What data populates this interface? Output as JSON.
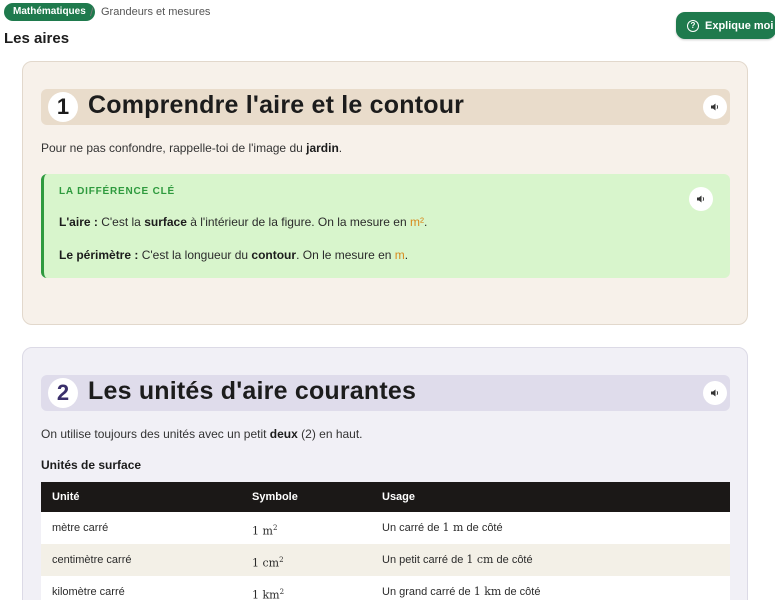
{
  "header": {
    "subject": "Mathématiques",
    "separator": "/",
    "topic": "Grandeurs et mesures",
    "title": "Les aires",
    "explain_button": "Explique moi",
    "explain_icon": "help-circle-icon"
  },
  "section1": {
    "number": "1",
    "title": "Comprendre l'aire et le contour",
    "intro_before": "Pour ne pas confondre, rappelle-toi de l'image du ",
    "intro_bold": "jardin",
    "intro_after": ".",
    "callout": {
      "title": "LA DIFFÉRENCE CLÉ",
      "area": {
        "label": "L'aire :",
        "text1": " C'est la ",
        "bold": "surface",
        "text2": " à l'intérieur de la figure. On la mesure en ",
        "unit": "m²",
        "end": "."
      },
      "perimeter": {
        "label": "Le périmètre :",
        "text1": " C'est la longueur du ",
        "bold": "contour",
        "text2": ". On le mesure en ",
        "unit": "m",
        "end": "."
      }
    }
  },
  "section2": {
    "number": "2",
    "title": "Les unités d'aire courantes",
    "intro_before": "On utilise toujours des unités avec un petit ",
    "intro_bold": "deux",
    "intro_after": " (2) en haut.",
    "table_title": "Unités de surface",
    "columns": [
      "Unité",
      "Symbole",
      "Usage"
    ],
    "rows": [
      {
        "unit": "mètre carré",
        "symbol_base": "1 m",
        "symbol_exp": "2",
        "usage_a": "Un carré de ",
        "usage_m": "1 m",
        "usage_b": " de côté"
      },
      {
        "unit": "centimètre carré",
        "symbol_base": "1 cm",
        "symbol_exp": "2",
        "usage_a": "Un petit carré de ",
        "usage_m": "1 cm",
        "usage_b": " de côté"
      },
      {
        "unit": "kilomètre carré",
        "symbol_base": "1 km",
        "symbol_exp": "2",
        "usage_a": "Un grand carré de ",
        "usage_m": "1 km",
        "usage_b": " de côté"
      }
    ]
  },
  "colors": {
    "brand_green": "#1f7a4d",
    "callout_green": "#2e9a3e",
    "unit_orange": "#d88a1d",
    "table_header": "#1b1817"
  }
}
